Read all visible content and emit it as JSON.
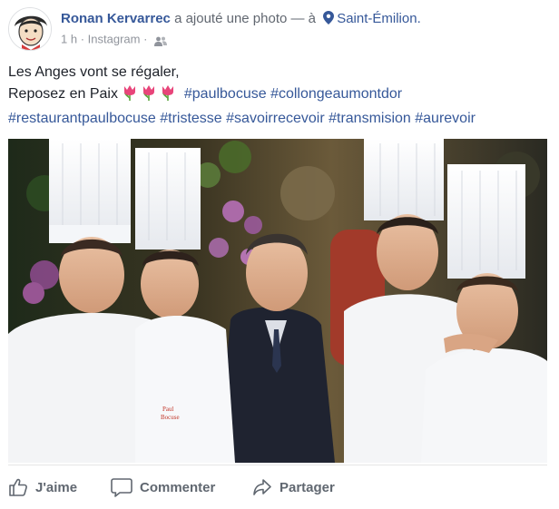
{
  "post": {
    "author": "Ronan Kervarrec",
    "action_text": "a ajouté une photo — à",
    "place": "Saint-Émilion.",
    "time": "1 h",
    "separator": "·",
    "source": "Instagram",
    "separator2": "·",
    "caption_line1": "Les Anges vont se régaler,",
    "caption_line2_prefix": "Reposez en Paix",
    "hashtags": [
      "#paulbocuse",
      "#collongeaumontdor",
      "#restaurantpaulbocuse",
      "#tristesse",
      "#savoirrecevoir",
      "#transmision",
      "#aurevoir"
    ],
    "photo_alt": "",
    "apron_text_1": "Paul",
    "apron_text_2": "Bocuse"
  },
  "actions": {
    "like_label": "J'aime",
    "comment_label": "Commenter",
    "share_label": "Partager"
  },
  "icons": {
    "location": "map-pin-icon",
    "audience": "friends-icon",
    "like": "thumbs-up-icon",
    "comment": "speech-bubble-icon",
    "share": "share-arrow-icon",
    "emoji": "tulip-emoji"
  },
  "colors": {
    "link": "#365899",
    "meta": "#90949c",
    "action_text": "#606770",
    "text": "#1d2129",
    "tulip_petal": "#e8457a",
    "tulip_leaf": "#5aa33a"
  }
}
